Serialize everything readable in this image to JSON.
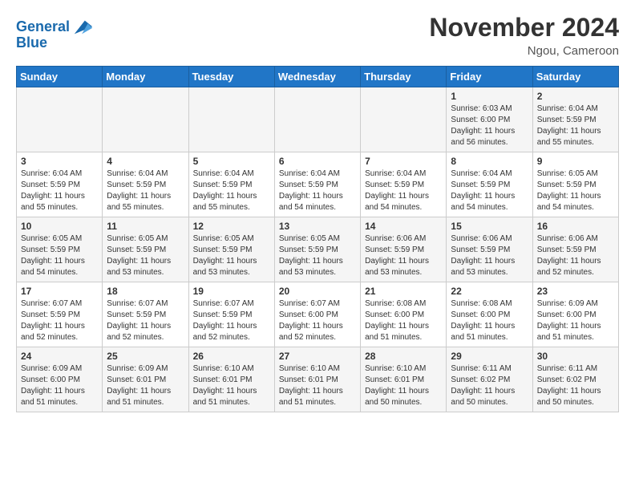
{
  "header": {
    "logo_line1": "General",
    "logo_line2": "Blue",
    "month_title": "November 2024",
    "location": "Ngou, Cameroon"
  },
  "weekdays": [
    "Sunday",
    "Monday",
    "Tuesday",
    "Wednesday",
    "Thursday",
    "Friday",
    "Saturday"
  ],
  "weeks": [
    [
      {
        "day": "",
        "info": ""
      },
      {
        "day": "",
        "info": ""
      },
      {
        "day": "",
        "info": ""
      },
      {
        "day": "",
        "info": ""
      },
      {
        "day": "",
        "info": ""
      },
      {
        "day": "1",
        "info": "Sunrise: 6:03 AM\nSunset: 6:00 PM\nDaylight: 11 hours\nand 56 minutes."
      },
      {
        "day": "2",
        "info": "Sunrise: 6:04 AM\nSunset: 5:59 PM\nDaylight: 11 hours\nand 55 minutes."
      }
    ],
    [
      {
        "day": "3",
        "info": "Sunrise: 6:04 AM\nSunset: 5:59 PM\nDaylight: 11 hours\nand 55 minutes."
      },
      {
        "day": "4",
        "info": "Sunrise: 6:04 AM\nSunset: 5:59 PM\nDaylight: 11 hours\nand 55 minutes."
      },
      {
        "day": "5",
        "info": "Sunrise: 6:04 AM\nSunset: 5:59 PM\nDaylight: 11 hours\nand 55 minutes."
      },
      {
        "day": "6",
        "info": "Sunrise: 6:04 AM\nSunset: 5:59 PM\nDaylight: 11 hours\nand 54 minutes."
      },
      {
        "day": "7",
        "info": "Sunrise: 6:04 AM\nSunset: 5:59 PM\nDaylight: 11 hours\nand 54 minutes."
      },
      {
        "day": "8",
        "info": "Sunrise: 6:04 AM\nSunset: 5:59 PM\nDaylight: 11 hours\nand 54 minutes."
      },
      {
        "day": "9",
        "info": "Sunrise: 6:05 AM\nSunset: 5:59 PM\nDaylight: 11 hours\nand 54 minutes."
      }
    ],
    [
      {
        "day": "10",
        "info": "Sunrise: 6:05 AM\nSunset: 5:59 PM\nDaylight: 11 hours\nand 54 minutes."
      },
      {
        "day": "11",
        "info": "Sunrise: 6:05 AM\nSunset: 5:59 PM\nDaylight: 11 hours\nand 53 minutes."
      },
      {
        "day": "12",
        "info": "Sunrise: 6:05 AM\nSunset: 5:59 PM\nDaylight: 11 hours\nand 53 minutes."
      },
      {
        "day": "13",
        "info": "Sunrise: 6:05 AM\nSunset: 5:59 PM\nDaylight: 11 hours\nand 53 minutes."
      },
      {
        "day": "14",
        "info": "Sunrise: 6:06 AM\nSunset: 5:59 PM\nDaylight: 11 hours\nand 53 minutes."
      },
      {
        "day": "15",
        "info": "Sunrise: 6:06 AM\nSunset: 5:59 PM\nDaylight: 11 hours\nand 53 minutes."
      },
      {
        "day": "16",
        "info": "Sunrise: 6:06 AM\nSunset: 5:59 PM\nDaylight: 11 hours\nand 52 minutes."
      }
    ],
    [
      {
        "day": "17",
        "info": "Sunrise: 6:07 AM\nSunset: 5:59 PM\nDaylight: 11 hours\nand 52 minutes."
      },
      {
        "day": "18",
        "info": "Sunrise: 6:07 AM\nSunset: 5:59 PM\nDaylight: 11 hours\nand 52 minutes."
      },
      {
        "day": "19",
        "info": "Sunrise: 6:07 AM\nSunset: 5:59 PM\nDaylight: 11 hours\nand 52 minutes."
      },
      {
        "day": "20",
        "info": "Sunrise: 6:07 AM\nSunset: 6:00 PM\nDaylight: 11 hours\nand 52 minutes."
      },
      {
        "day": "21",
        "info": "Sunrise: 6:08 AM\nSunset: 6:00 PM\nDaylight: 11 hours\nand 51 minutes."
      },
      {
        "day": "22",
        "info": "Sunrise: 6:08 AM\nSunset: 6:00 PM\nDaylight: 11 hours\nand 51 minutes."
      },
      {
        "day": "23",
        "info": "Sunrise: 6:09 AM\nSunset: 6:00 PM\nDaylight: 11 hours\nand 51 minutes."
      }
    ],
    [
      {
        "day": "24",
        "info": "Sunrise: 6:09 AM\nSunset: 6:00 PM\nDaylight: 11 hours\nand 51 minutes."
      },
      {
        "day": "25",
        "info": "Sunrise: 6:09 AM\nSunset: 6:01 PM\nDaylight: 11 hours\nand 51 minutes."
      },
      {
        "day": "26",
        "info": "Sunrise: 6:10 AM\nSunset: 6:01 PM\nDaylight: 11 hours\nand 51 minutes."
      },
      {
        "day": "27",
        "info": "Sunrise: 6:10 AM\nSunset: 6:01 PM\nDaylight: 11 hours\nand 51 minutes."
      },
      {
        "day": "28",
        "info": "Sunrise: 6:10 AM\nSunset: 6:01 PM\nDaylight: 11 hours\nand 50 minutes."
      },
      {
        "day": "29",
        "info": "Sunrise: 6:11 AM\nSunset: 6:02 PM\nDaylight: 11 hours\nand 50 minutes."
      },
      {
        "day": "30",
        "info": "Sunrise: 6:11 AM\nSunset: 6:02 PM\nDaylight: 11 hours\nand 50 minutes."
      }
    ]
  ]
}
